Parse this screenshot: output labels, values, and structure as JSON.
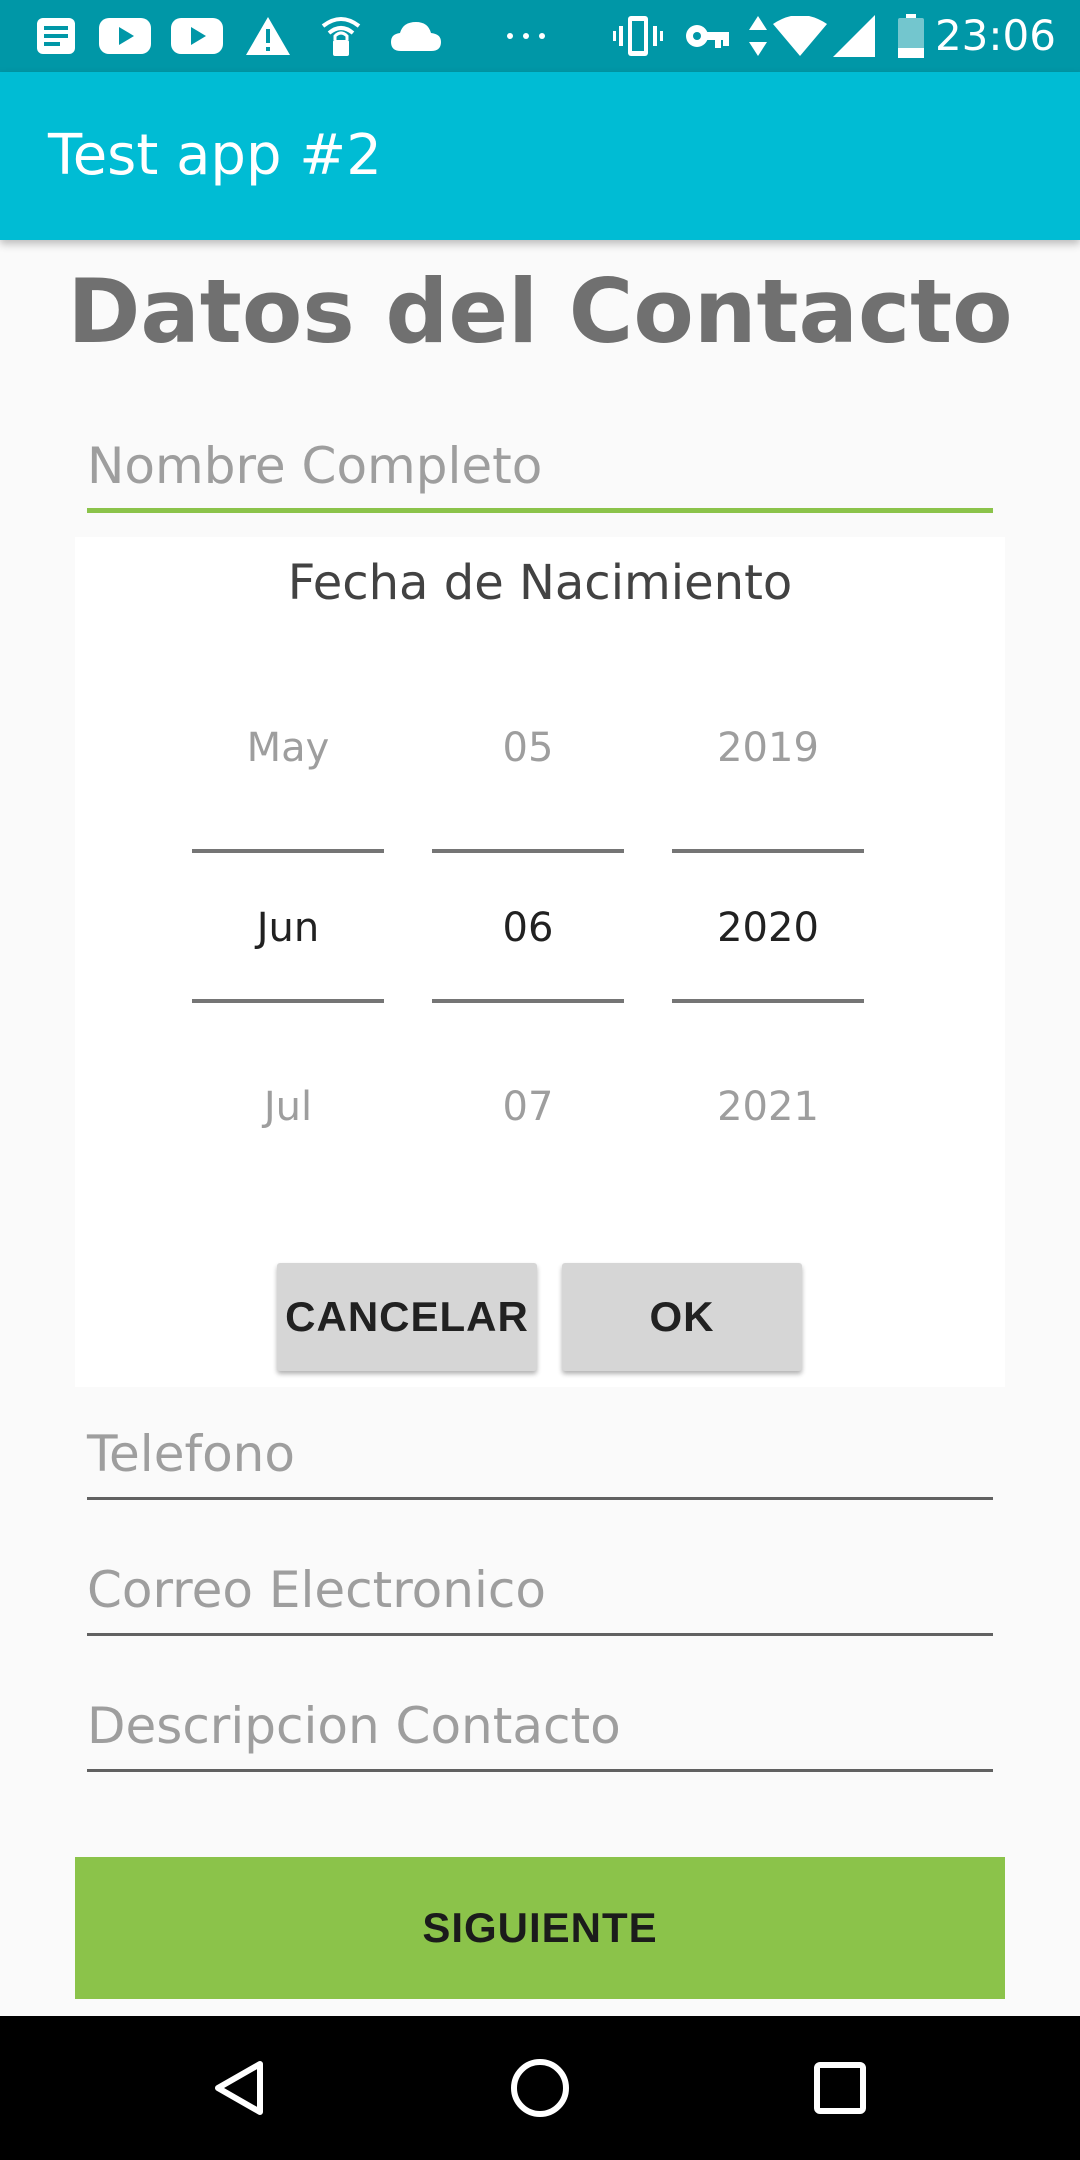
{
  "status_bar": {
    "time": "23:06",
    "left_icons": [
      "notes-icon",
      "youtube-icon",
      "youtube-icon",
      "warning-icon",
      "wifi-hotspot-icon",
      "cloud-icon",
      "more-dots-icon"
    ],
    "right_icons": [
      "vibrate-icon",
      "vpn-key-icon",
      "data-arrows-icon",
      "wifi-icon",
      "cell-signal-icon",
      "battery-icon"
    ]
  },
  "app_bar": {
    "title": "Test app #2"
  },
  "form": {
    "heading": "Datos del Contacto",
    "name_placeholder": "Nombre Completo",
    "phone_placeholder": "Telefono",
    "email_placeholder": "Correo Electronico",
    "description_placeholder": "Descripcion Contacto",
    "next_button": "SIGUIENTE"
  },
  "date_picker": {
    "title": "Fecha de Nacimiento",
    "month": {
      "prev": "May",
      "selected": "Jun",
      "next": "Jul"
    },
    "day": {
      "prev": "05",
      "selected": "06",
      "next": "07"
    },
    "year": {
      "prev": "2019",
      "selected": "2020",
      "next": "2021"
    },
    "cancel_label": "CANCELAR",
    "ok_label": "OK"
  },
  "nav_bar": {
    "buttons": [
      "back-icon",
      "home-icon",
      "recents-icon"
    ]
  },
  "colors": {
    "status_bar": "#0097a7",
    "app_bar": "#00bcd4",
    "accent": "#8bc34a",
    "button_gray": "#d6d6d6"
  }
}
